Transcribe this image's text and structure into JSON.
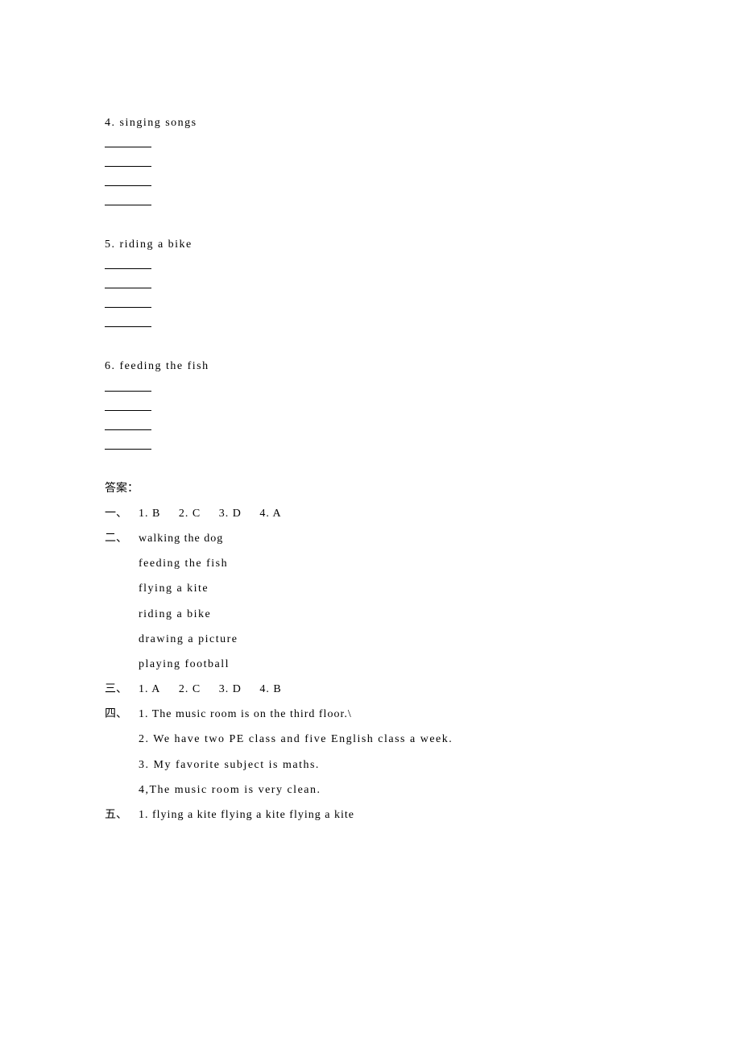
{
  "exercises": {
    "item4": "4. singing songs",
    "item5": "5. riding a bike",
    "item6": "6. feeding the fish"
  },
  "answers": {
    "title": "答案：",
    "section1": {
      "label": "一、",
      "items": [
        "1. B",
        "2. C",
        "3. D",
        "4. A"
      ]
    },
    "section2": {
      "label": "二、",
      "lines": [
        "walking the dog",
        "feeding the fish",
        "flying a kite",
        "riding a bike",
        "drawing a picture",
        "playing football"
      ]
    },
    "section3": {
      "label": "三、",
      "items": [
        "1. A",
        "2. C",
        "3. D",
        "4. B"
      ]
    },
    "section4": {
      "label": "四、",
      "lines": [
        "1. The music room is on the third floor.\\",
        "2. We have two PE class and five English class a week.",
        "3. My favorite subject is maths.",
        "4,The music room is very clean."
      ]
    },
    "section5": {
      "label": "五、",
      "line": " 1. flying a kite  flying a kite  flying a kite"
    }
  }
}
